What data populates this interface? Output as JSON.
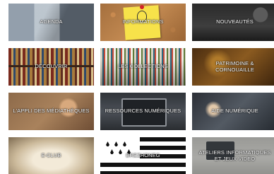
{
  "tiles": [
    {
      "label": "AGENDA",
      "icon": "calendar-photo"
    },
    {
      "label": "INFORMATIONS",
      "icon": "sticky-note-photo"
    },
    {
      "label": "NOUVEAUTÉS",
      "icon": "headphones-photo"
    },
    {
      "label": "DÉCOUVRIR",
      "icon": "bookshelf-photo"
    },
    {
      "label": "LES COLLECTIONS",
      "icon": "library-shelves-photo"
    },
    {
      "label": "PATRIMOINE & CORNOUAILLE",
      "icon": "heritage-photo"
    },
    {
      "label": "L'APPLI DES MÉDIATHÈQUES",
      "icon": "smartphone-photo"
    },
    {
      "label": "RESSOURCES NUMÉRIQUES",
      "icon": "laptop-photo"
    },
    {
      "label": "AIDE NUMÉRIQUE",
      "icon": "typing-photo"
    },
    {
      "label": "E-CLUB",
      "icon": "open-book-photo"
    },
    {
      "label": "BREZHONEG",
      "icon": "breton-flag-photo"
    },
    {
      "label": "ATELIERS INFORMATIQUES ET JEUX VIDÉO",
      "icon": "computer-workshop-photo"
    }
  ]
}
